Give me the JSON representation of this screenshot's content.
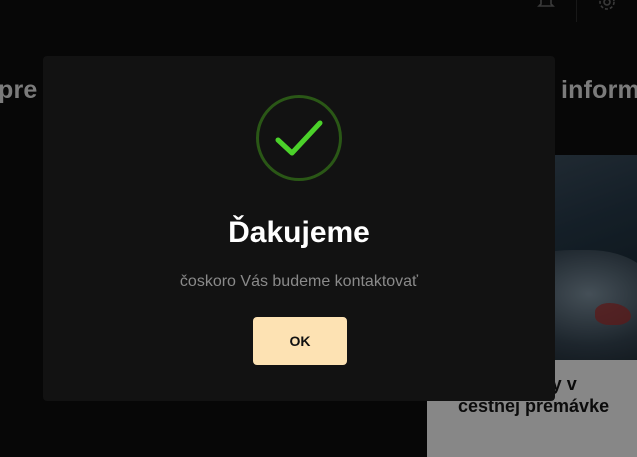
{
  "background": {
    "heading_left": "pre",
    "heading_right": "inform",
    "card_title": "Tieto zmeny v cestnej premávke",
    "icons": [
      "bell-icon",
      "gear-icon"
    ]
  },
  "modal": {
    "icon": "checkmark-icon",
    "title": "Ďakujeme",
    "message": "čoskoro Vás budeme kontaktovať",
    "ok_label": "OK"
  },
  "colors": {
    "modal_bg": "#121212",
    "check_green": "#4bd12a",
    "check_ring": "#2a5716",
    "button_bg": "#fde2b3"
  }
}
